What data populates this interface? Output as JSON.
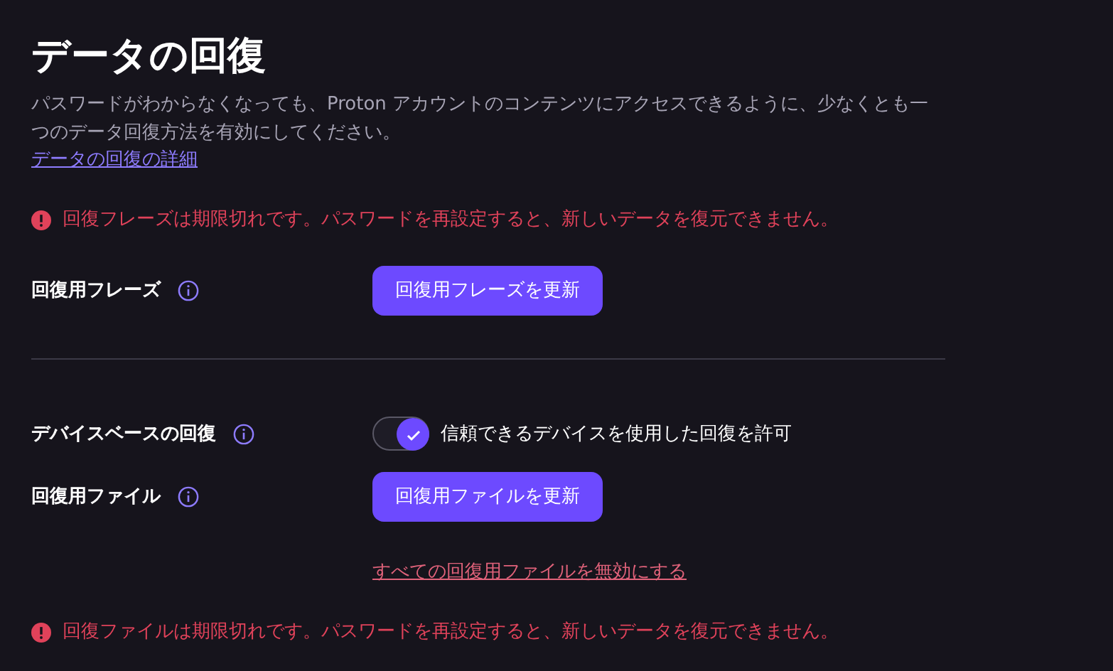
{
  "title": "データの回復",
  "description": "パスワードがわからなくなっても、Proton アカウントのコンテンツにアクセスできるように、少なくとも一つのデータ回復方法を有効にしてください。",
  "learn_more_link": "データの回復の詳細",
  "items": [
    {
      "kind": "alert",
      "text": "回復フレーズは期限切れです。パスワードを再設定すると、新しいデータを復元できません。"
    },
    {
      "kind": "setting",
      "label": "回復用フレーズ",
      "control": {
        "kind": "button",
        "label": "回復用フレーズを更新"
      }
    },
    {
      "kind": "divider"
    },
    {
      "kind": "setting",
      "label": "デバイスベースの回復",
      "control": {
        "kind": "toggle",
        "on": true,
        "label": "信頼できるデバイスを使用した回復を許可"
      }
    },
    {
      "kind": "setting",
      "label": "回復用ファイル",
      "control": {
        "kind": "button",
        "label": "回復用ファイルを更新"
      }
    },
    {
      "kind": "link",
      "text": "すべての回復用ファイルを無効にする"
    },
    {
      "kind": "alert",
      "text": "回復ファイルは期限切れです。パスワードを再設定すると、新しいデータを復元できません。"
    }
  ]
}
